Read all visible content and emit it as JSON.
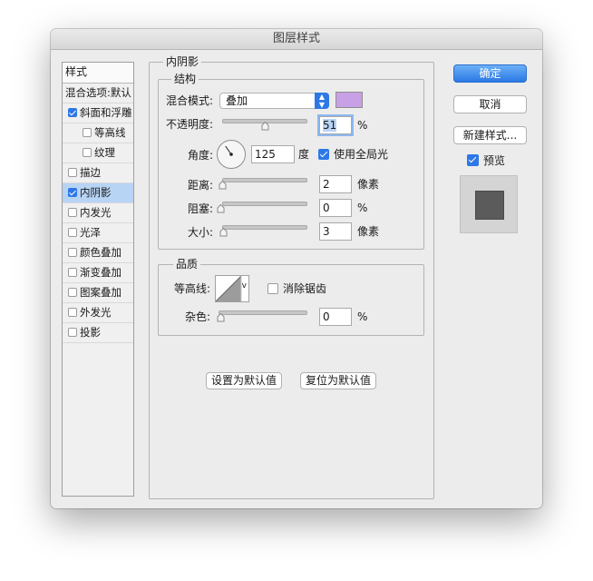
{
  "dialog": {
    "title": "图层样式"
  },
  "style_list": {
    "header": "样式",
    "blend_options": "混合选项:默认",
    "items": [
      {
        "label": "斜面和浮雕",
        "checked": true,
        "selected": false,
        "indent": false
      },
      {
        "label": "等高线",
        "checked": false,
        "selected": false,
        "indent": true
      },
      {
        "label": "纹理",
        "checked": false,
        "selected": false,
        "indent": true
      },
      {
        "label": "描边",
        "checked": false,
        "selected": false,
        "indent": false
      },
      {
        "label": "内阴影",
        "checked": true,
        "selected": true,
        "indent": false
      },
      {
        "label": "内发光",
        "checked": false,
        "selected": false,
        "indent": false
      },
      {
        "label": "光泽",
        "checked": false,
        "selected": false,
        "indent": false
      },
      {
        "label": "颜色叠加",
        "checked": false,
        "selected": false,
        "indent": false
      },
      {
        "label": "渐变叠加",
        "checked": false,
        "selected": false,
        "indent": false
      },
      {
        "label": "图案叠加",
        "checked": false,
        "selected": false,
        "indent": false
      },
      {
        "label": "外发光",
        "checked": false,
        "selected": false,
        "indent": false
      },
      {
        "label": "投影",
        "checked": false,
        "selected": false,
        "indent": false
      }
    ]
  },
  "inner_shadow": {
    "title": "内阴影",
    "structure": {
      "title": "结构",
      "blend_mode_label": "混合模式:",
      "blend_mode_value": "叠加",
      "shadow_color": "#c7a0e6",
      "opacity_label": "不透明度:",
      "opacity_value": "51",
      "opacity_unit": "%",
      "opacity_level": 0.51,
      "angle_label": "角度:",
      "angle_value": "125",
      "angle_unit": "度",
      "global_light_label": "使用全局光",
      "global_light_checked": true,
      "distance_label": "距离:",
      "distance_value": "2",
      "distance_unit": "像素",
      "choke_label": "阻塞:",
      "choke_value": "0",
      "choke_unit": "%",
      "size_label": "大小:",
      "size_value": "3",
      "size_unit": "像素"
    },
    "quality": {
      "title": "品质",
      "contour_label": "等高线:",
      "contour_dropdown": "v",
      "antialias_label": "消除锯齿",
      "antialias_checked": false,
      "noise_label": "杂色:",
      "noise_value": "0",
      "noise_unit": "%"
    },
    "set_default": "设置为默认值",
    "reset_default": "复位为默认值"
  },
  "actions": {
    "ok": "确定",
    "cancel": "取消",
    "new_style": "新建样式...",
    "preview_label": "预览",
    "preview_checked": true
  },
  "colors": {
    "accent": "#2d78e6",
    "selection": "#b8d4f5"
  }
}
